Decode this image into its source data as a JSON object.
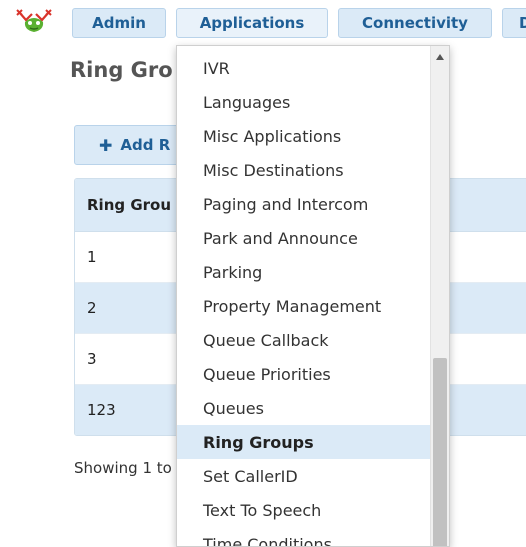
{
  "nav": {
    "items": [
      {
        "label": "Admin"
      },
      {
        "label": "Applications"
      },
      {
        "label": "Connectivity"
      },
      {
        "label": "D"
      }
    ]
  },
  "page": {
    "title": "Ring Gro",
    "add_button_label": "Add R",
    "table_header": "Ring Grou",
    "rows": [
      "1",
      "2",
      "3",
      "123"
    ],
    "footer": "Showing 1 to"
  },
  "dropdown": {
    "items": [
      {
        "label": "IVR"
      },
      {
        "label": "Languages"
      },
      {
        "label": "Misc Applications"
      },
      {
        "label": "Misc Destinations"
      },
      {
        "label": "Paging and Intercom"
      },
      {
        "label": "Park and Announce"
      },
      {
        "label": "Parking"
      },
      {
        "label": "Property Management"
      },
      {
        "label": "Queue Callback"
      },
      {
        "label": "Queue Priorities"
      },
      {
        "label": "Queues"
      },
      {
        "label": "Ring Groups"
      },
      {
        "label": "Set CallerID"
      },
      {
        "label": "Text To Speech"
      },
      {
        "label": "Time Conditions"
      }
    ],
    "active": "Ring Groups"
  },
  "colors": {
    "nav_bg": "#dbeaf7",
    "nav_text": "#1f5f96",
    "highlight": "#dbeaf7"
  }
}
